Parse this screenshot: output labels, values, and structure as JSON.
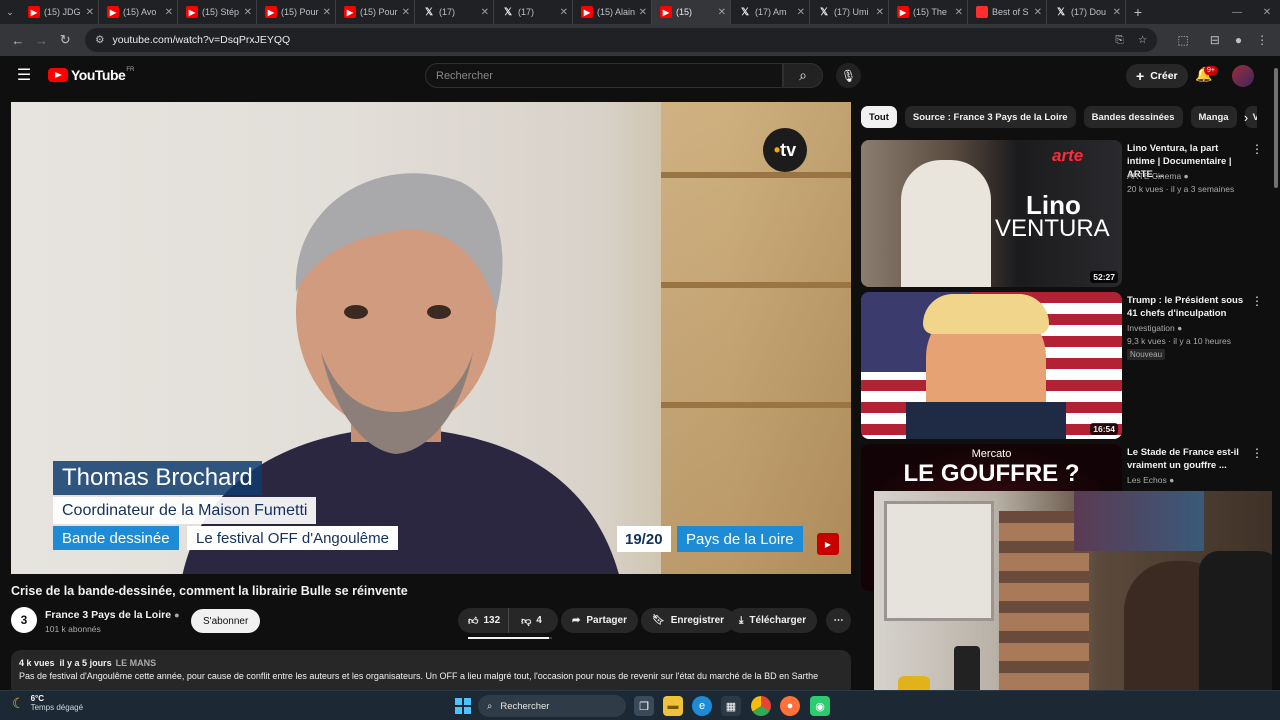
{
  "browser": {
    "tabs": [
      {
        "title": "(15) JDG",
        "icon": "youtube-icon"
      },
      {
        "title": "(15) Avo",
        "icon": "youtube-icon"
      },
      {
        "title": "(15) Stép",
        "icon": "youtube-icon"
      },
      {
        "title": "(15) Pour",
        "icon": "youtube-icon"
      },
      {
        "title": "(15) Pour",
        "icon": "youtube-icon"
      },
      {
        "title": "(17)",
        "icon": "x-icon"
      },
      {
        "title": "(17)",
        "icon": "x-icon"
      },
      {
        "title": "(15) Alain",
        "icon": "youtube-icon"
      },
      {
        "title": "(15)",
        "icon": "youtube-icon",
        "active": true
      },
      {
        "title": "(17) Am",
        "icon": "x-icon"
      },
      {
        "title": "(17) Umi",
        "icon": "x-icon"
      },
      {
        "title": "(15) The",
        "icon": "youtube-icon"
      },
      {
        "title": "Best of S",
        "icon": "bookmark-icon"
      },
      {
        "title": "(17) Dou",
        "icon": "x-icon"
      }
    ],
    "url": "youtube.com/watch?v=DsqPrxJEYQQ"
  },
  "header": {
    "logo_text": "YouTube",
    "region": "FR",
    "search_placeholder": "Rechercher",
    "create_label": "Créer",
    "notif_count": "9+"
  },
  "video": {
    "title": "Crise de la bande-dessinée, comment la librairie Bulle se réinvente",
    "lower_third_name": "Thomas Brochard",
    "lower_third_role": "Coordinateur de la Maison Fumetti",
    "lower_third_category": "Bande dessinée",
    "lower_third_topic": "Le festival OFF d'Angoulême",
    "program_time": "19/20",
    "program_region": "Pays de la Loire",
    "watermark": "tv",
    "channel_avatar": "3",
    "channel_name": "France 3 Pays de la Loire",
    "subscribers": "101 k abonnés",
    "subscribe_label": "S'abonner",
    "likes": "132",
    "dislikes": "4",
    "like_ratio": 0.97,
    "share_label": "Partager",
    "save_label": "Enregistrer",
    "download_label": "Télécharger",
    "views": "4 k vues",
    "age": "il y a 5 jours",
    "tag": "LE MANS",
    "description": "Pas de festival d'Angoulême cette année, pour cause de conflit entre les auteurs et les organisateurs. Un OFF a lieu malgré tout, l'occasion pour nous de revenir sur l'état du marché de la BD en Sarthe"
  },
  "chips": [
    "Tout",
    "Source : France 3 Pays de la Loire",
    "Bandes dessinées",
    "Manga",
    "V"
  ],
  "recommendations": [
    {
      "title": "Lino Ventura, la part intime | Documentaire | ARTE ...",
      "channel": "ARTE Cinema",
      "meta": "20 k vues · il y a 3 semaines",
      "duration": "52:27",
      "thumb_text_1": "arte",
      "thumb_text_2": "Lino",
      "thumb_text_3": "VENTURA"
    },
    {
      "title": "Trump : le Président sous 41 chefs d'inculpation",
      "channel": "Investigation",
      "meta": "9,3 k vues · il y a 10 heures",
      "badge": "Nouveau",
      "duration": "16:54"
    },
    {
      "title": "Le Stade de France est-il vraiment un gouffre ...",
      "channel": "Les Echos",
      "meta": "",
      "thumb_text_1": "Mercato",
      "thumb_text_2": "LE GOUFFRE ?"
    }
  ],
  "taskbar": {
    "temperature": "6°C",
    "weather": "Temps dégagé",
    "search_label": "Rechercher"
  },
  "colors": {
    "youtube_red": "#ff0000",
    "background": "#0f0f0f",
    "france3_blue": "#1e8bd6"
  }
}
